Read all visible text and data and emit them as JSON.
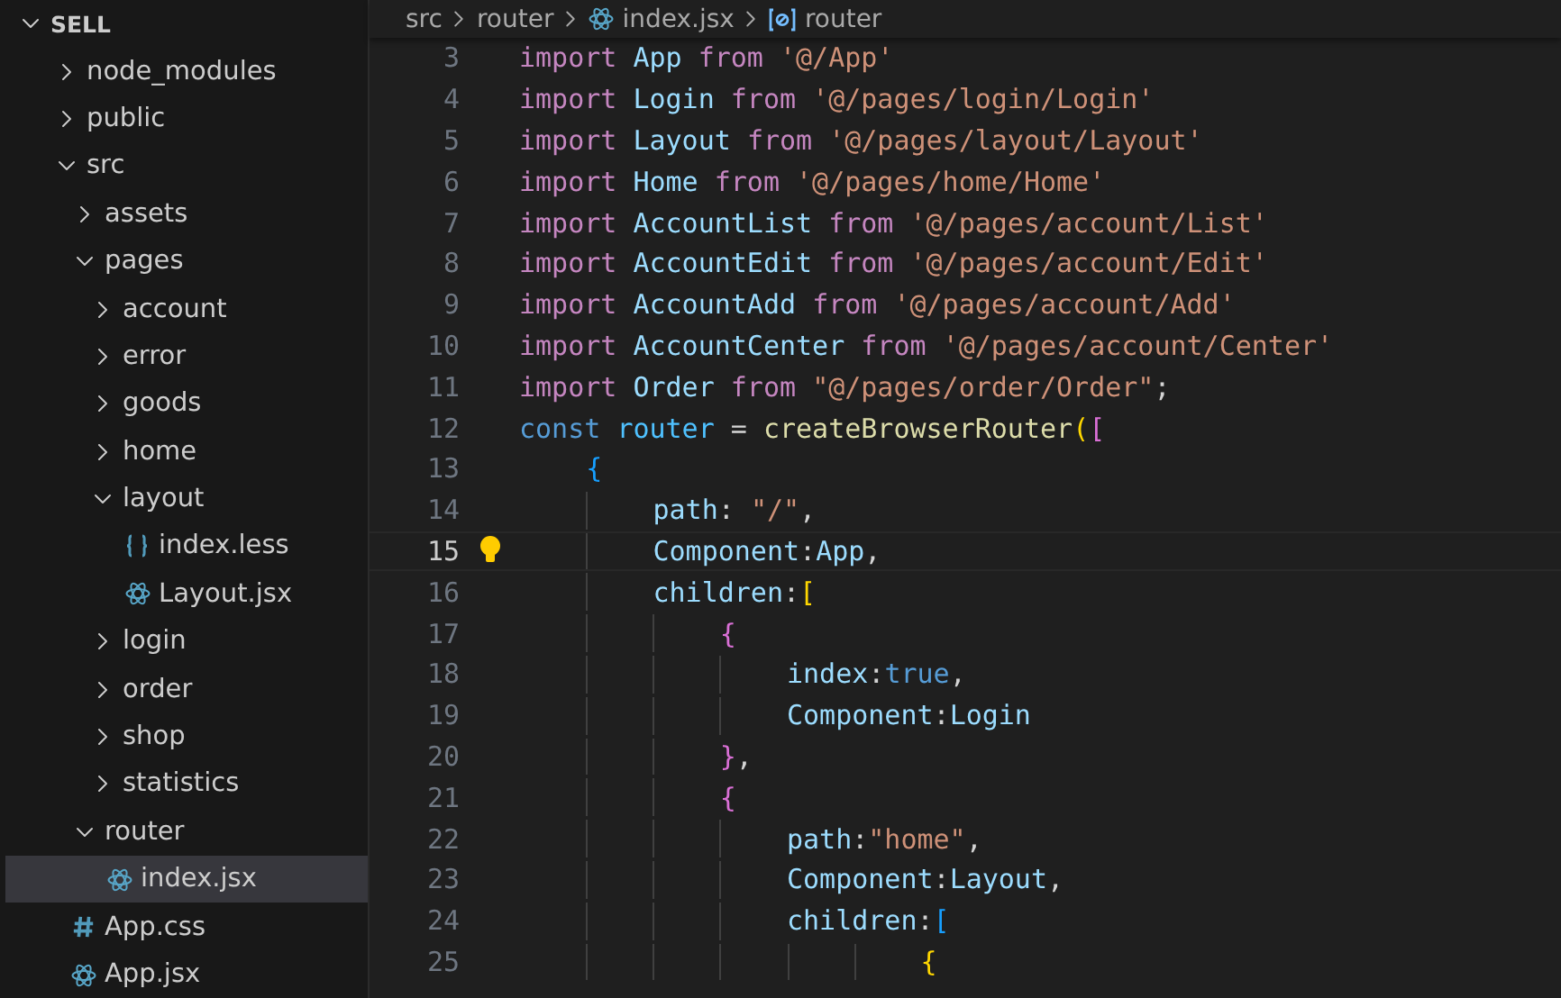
{
  "explorer": {
    "title": "SELL",
    "expanded": true,
    "items": [
      {
        "name": "node_modules",
        "kind": "folder",
        "expanded": false,
        "selected": false
      },
      {
        "name": "public",
        "kind": "folder",
        "expanded": false,
        "selected": false
      },
      {
        "name": "src",
        "kind": "folder",
        "expanded": true,
        "selected": false,
        "children": [
          {
            "name": "assets",
            "kind": "folder",
            "expanded": false,
            "selected": false
          },
          {
            "name": "pages",
            "kind": "folder",
            "expanded": true,
            "selected": false,
            "children": [
              {
                "name": "account",
                "kind": "folder",
                "expanded": false,
                "selected": false
              },
              {
                "name": "error",
                "kind": "folder",
                "expanded": false,
                "selected": false
              },
              {
                "name": "goods",
                "kind": "folder",
                "expanded": false,
                "selected": false
              },
              {
                "name": "home",
                "kind": "folder",
                "expanded": false,
                "selected": false
              },
              {
                "name": "layout",
                "kind": "folder",
                "expanded": true,
                "selected": false,
                "children": [
                  {
                    "name": "index.less",
                    "kind": "less",
                    "selected": false
                  },
                  {
                    "name": "Layout.jsx",
                    "kind": "react",
                    "selected": false
                  }
                ]
              },
              {
                "name": "login",
                "kind": "folder",
                "expanded": false,
                "selected": false
              },
              {
                "name": "order",
                "kind": "folder",
                "expanded": false,
                "selected": false
              },
              {
                "name": "shop",
                "kind": "folder",
                "expanded": false,
                "selected": false
              },
              {
                "name": "statistics",
                "kind": "folder",
                "expanded": false,
                "selected": false
              }
            ]
          },
          {
            "name": "router",
            "kind": "folder",
            "expanded": true,
            "selected": false,
            "children": [
              {
                "name": "index.jsx",
                "kind": "react",
                "selected": true
              }
            ]
          }
        ]
      },
      {
        "name": "App.css",
        "kind": "css",
        "selected": false
      },
      {
        "name": "App.jsx",
        "kind": "react",
        "selected": false
      }
    ]
  },
  "breadcrumb": [
    {
      "label": "src",
      "kind": "folder"
    },
    {
      "label": "router",
      "kind": "folder"
    },
    {
      "label": "index.jsx",
      "kind": "react"
    },
    {
      "label": "router",
      "kind": "symbol"
    }
  ],
  "editor": {
    "lines": [
      {
        "number": "3",
        "current": false,
        "tokens": [
          {
            "text": "import ",
            "kind": "keyword"
          },
          {
            "text": "App ",
            "kind": "variable"
          },
          {
            "text": "from ",
            "kind": "keyword"
          },
          {
            "text": "'@/App'",
            "kind": "string"
          }
        ]
      },
      {
        "number": "4",
        "current": false,
        "tokens": [
          {
            "text": "import ",
            "kind": "keyword"
          },
          {
            "text": "Login ",
            "kind": "variable"
          },
          {
            "text": "from ",
            "kind": "keyword"
          },
          {
            "text": "'@/pages/login/Login'",
            "kind": "string"
          }
        ]
      },
      {
        "number": "5",
        "current": false,
        "tokens": [
          {
            "text": "import ",
            "kind": "keyword"
          },
          {
            "text": "Layout ",
            "kind": "variable"
          },
          {
            "text": "from ",
            "kind": "keyword"
          },
          {
            "text": "'@/pages/layout/Layout'",
            "kind": "string"
          }
        ]
      },
      {
        "number": "6",
        "current": false,
        "tokens": [
          {
            "text": "import ",
            "kind": "keyword"
          },
          {
            "text": "Home ",
            "kind": "variable"
          },
          {
            "text": "from ",
            "kind": "keyword"
          },
          {
            "text": "'@/pages/home/Home'",
            "kind": "string"
          }
        ]
      },
      {
        "number": "7",
        "current": false,
        "tokens": [
          {
            "text": "import ",
            "kind": "keyword"
          },
          {
            "text": "AccountList ",
            "kind": "variable"
          },
          {
            "text": "from ",
            "kind": "keyword"
          },
          {
            "text": "'@/pages/account/List'",
            "kind": "string"
          }
        ]
      },
      {
        "number": "8",
        "current": false,
        "tokens": [
          {
            "text": "import ",
            "kind": "keyword"
          },
          {
            "text": "AccountEdit ",
            "kind": "variable"
          },
          {
            "text": "from ",
            "kind": "keyword"
          },
          {
            "text": "'@/pages/account/Edit'",
            "kind": "string"
          }
        ]
      },
      {
        "number": "9",
        "current": false,
        "tokens": [
          {
            "text": "import ",
            "kind": "keyword"
          },
          {
            "text": "AccountAdd ",
            "kind": "variable"
          },
          {
            "text": "from ",
            "kind": "keyword"
          },
          {
            "text": "'@/pages/account/Add'",
            "kind": "string"
          }
        ]
      },
      {
        "number": "10",
        "current": false,
        "tokens": [
          {
            "text": "import ",
            "kind": "keyword"
          },
          {
            "text": "AccountCenter ",
            "kind": "variable"
          },
          {
            "text": "from ",
            "kind": "keyword"
          },
          {
            "text": "'@/pages/account/Center'",
            "kind": "string"
          }
        ]
      },
      {
        "number": "11",
        "current": false,
        "tokens": [
          {
            "text": "import ",
            "kind": "keyword"
          },
          {
            "text": "Order ",
            "kind": "variable"
          },
          {
            "text": "from ",
            "kind": "keyword"
          },
          {
            "text": "\"@/pages/order/Order\"",
            "kind": "string"
          },
          {
            "text": ";",
            "kind": "plain"
          }
        ]
      },
      {
        "number": "12",
        "current": false,
        "tokens": [
          {
            "text": "const ",
            "kind": "storage"
          },
          {
            "text": "router",
            "kind": "constant"
          },
          {
            "text": " = ",
            "kind": "plain"
          },
          {
            "text": "createBrowserRouter",
            "kind": "function"
          },
          {
            "text": "(",
            "kind": "bracket1"
          },
          {
            "text": "[",
            "kind": "bracket2"
          }
        ]
      },
      {
        "number": "13",
        "current": false,
        "tokens": [
          {
            "text": "    {",
            "kind": "bracket3"
          }
        ]
      },
      {
        "number": "14",
        "current": false,
        "tokens": [
          {
            "text": "        path",
            "kind": "variable"
          },
          {
            "text": ": ",
            "kind": "plain"
          },
          {
            "text": "\"/\"",
            "kind": "string"
          },
          {
            "text": ",",
            "kind": "plain"
          }
        ]
      },
      {
        "number": "15",
        "current": true,
        "tokens": [
          {
            "text": "        Component",
            "kind": "variable"
          },
          {
            "text": ":",
            "kind": "plain"
          },
          {
            "text": "App",
            "kind": "variable"
          },
          {
            "text": ",",
            "kind": "plain"
          }
        ]
      },
      {
        "number": "16",
        "current": false,
        "tokens": [
          {
            "text": "        children",
            "kind": "variable"
          },
          {
            "text": ":",
            "kind": "plain"
          },
          {
            "text": "[",
            "kind": "bracket1"
          }
        ]
      },
      {
        "number": "17",
        "current": false,
        "tokens": [
          {
            "text": "            {",
            "kind": "bracket2"
          }
        ]
      },
      {
        "number": "18",
        "current": false,
        "tokens": [
          {
            "text": "                index",
            "kind": "variable"
          },
          {
            "text": ":",
            "kind": "plain"
          },
          {
            "text": "true",
            "kind": "storage"
          },
          {
            "text": ",",
            "kind": "plain"
          }
        ]
      },
      {
        "number": "19",
        "current": false,
        "tokens": [
          {
            "text": "                Component",
            "kind": "variable"
          },
          {
            "text": ":",
            "kind": "plain"
          },
          {
            "text": "Login",
            "kind": "variable"
          }
        ]
      },
      {
        "number": "20",
        "current": false,
        "tokens": [
          {
            "text": "            }",
            "kind": "bracket2"
          },
          {
            "text": ",",
            "kind": "plain"
          }
        ]
      },
      {
        "number": "21",
        "current": false,
        "tokens": [
          {
            "text": "            {",
            "kind": "bracket2"
          }
        ]
      },
      {
        "number": "22",
        "current": false,
        "tokens": [
          {
            "text": "                path",
            "kind": "variable"
          },
          {
            "text": ":",
            "kind": "plain"
          },
          {
            "text": "\"home\"",
            "kind": "string"
          },
          {
            "text": ",",
            "kind": "plain"
          }
        ]
      },
      {
        "number": "23",
        "current": false,
        "tokens": [
          {
            "text": "                Component",
            "kind": "variable"
          },
          {
            "text": ":",
            "kind": "plain"
          },
          {
            "text": "Layout",
            "kind": "variable"
          },
          {
            "text": ",",
            "kind": "plain"
          }
        ]
      },
      {
        "number": "24",
        "current": false,
        "tokens": [
          {
            "text": "                children",
            "kind": "variable"
          },
          {
            "text": ":",
            "kind": "plain"
          },
          {
            "text": "[",
            "kind": "bracket3"
          }
        ]
      },
      {
        "number": "25",
        "current": false,
        "tokens": [
          {
            "text": "                        {",
            "kind": "bracket1"
          }
        ]
      }
    ]
  }
}
